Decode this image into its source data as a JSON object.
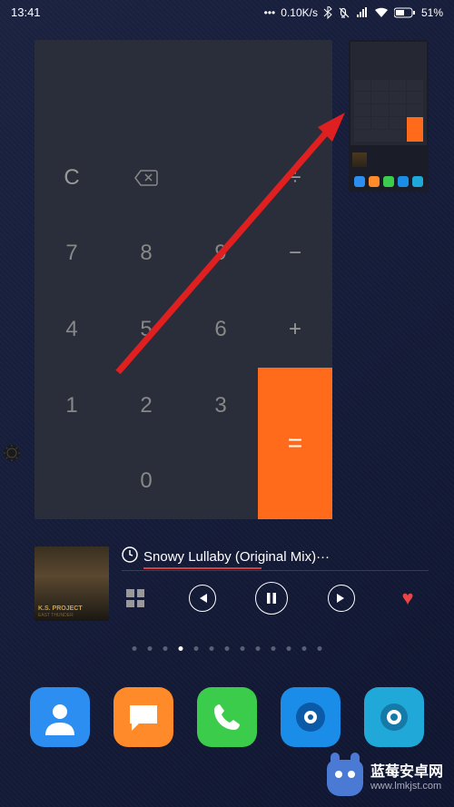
{
  "status": {
    "time": "13:41",
    "net_speed": "0.10K/s",
    "battery_pct": "51%"
  },
  "calculator": {
    "keys": {
      "clear": "C",
      "divide": "÷",
      "n7": "7",
      "n8": "8",
      "n9": "9",
      "minus": "−",
      "n4": "4",
      "n5": "5",
      "n6": "6",
      "plus": "+",
      "n1": "1",
      "n2": "2",
      "n3": "3",
      "n0": "0",
      "equals": "="
    }
  },
  "music": {
    "song_title": "Snowy Lullaby (Original Mix)···",
    "album_artist_label": "K.S. PROJECT",
    "album_sublabel": "EAST THUNDER"
  },
  "pagination": {
    "total": 13,
    "active_index": 3
  },
  "dock": {
    "contacts_color": "#2b8ef0",
    "messages_color": "#ff8a2a",
    "phone_color": "#3acc4a",
    "browser_color": "#1a8de8",
    "camera_color": "#20a8d8"
  },
  "watermark": {
    "title": "蓝莓安卓网",
    "url": "www.lmkjst.com"
  }
}
